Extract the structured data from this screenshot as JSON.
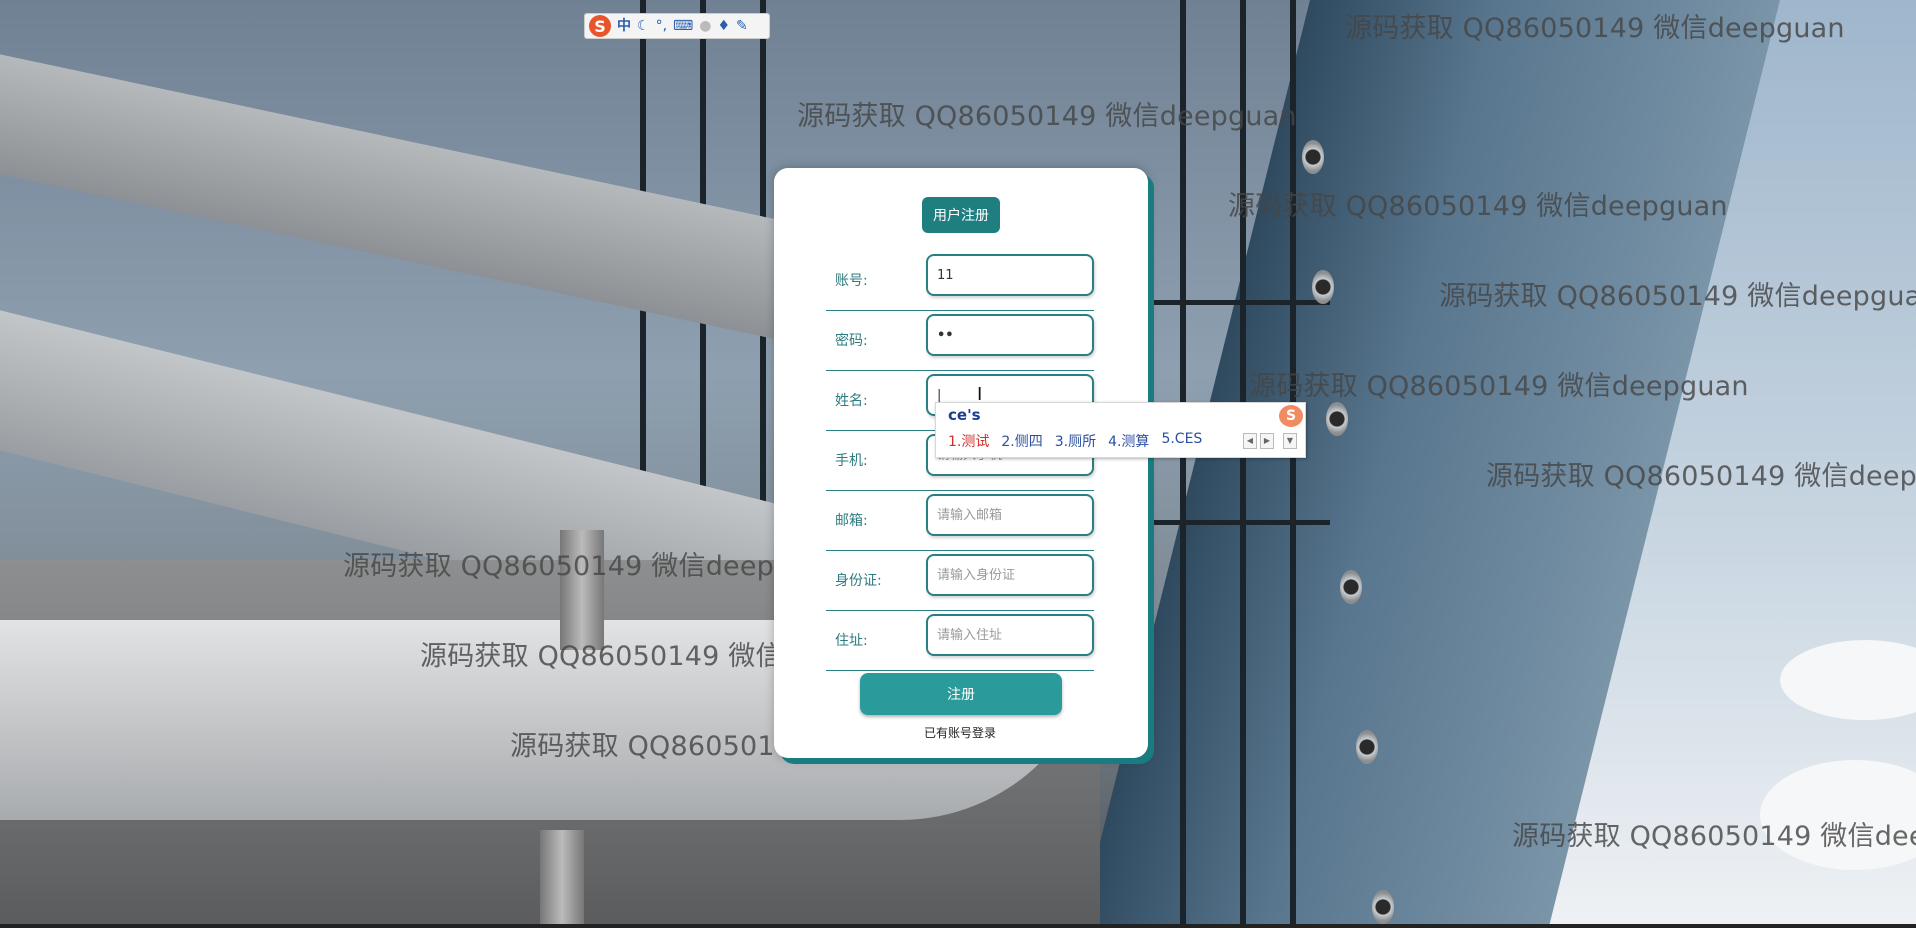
{
  "watermark_text": "源码获取 QQ86050149 微信deepguan",
  "ime_bar": {
    "logo": "S",
    "mode": "中",
    "icons": [
      "moon-icon",
      "punctuation-icon",
      "keyboard-icon",
      "user-icon",
      "skin-icon",
      "tools-icon"
    ]
  },
  "form": {
    "title": "用户注册",
    "fields": [
      {
        "label": "账号:",
        "value": "11",
        "placeholder": ""
      },
      {
        "label": "密码:",
        "value": "••",
        "placeholder": ""
      },
      {
        "label": "姓名:",
        "value": "|",
        "placeholder": ""
      },
      {
        "label": "手机:",
        "value": "",
        "placeholder": "请输入手机"
      },
      {
        "label": "邮箱:",
        "value": "",
        "placeholder": "请输入邮箱"
      },
      {
        "label": "身份证:",
        "value": "",
        "placeholder": "请输入身份证"
      },
      {
        "label": "住址:",
        "value": "",
        "placeholder": "请输入住址"
      }
    ],
    "submit_label": "注册",
    "login_link": "已有账号登录"
  },
  "ime_candidates": {
    "composition": "ce's",
    "logo": "S",
    "items": [
      "1.测试",
      "2.侧四",
      "3.厕所",
      "4.测算",
      "5.CES"
    ]
  }
}
